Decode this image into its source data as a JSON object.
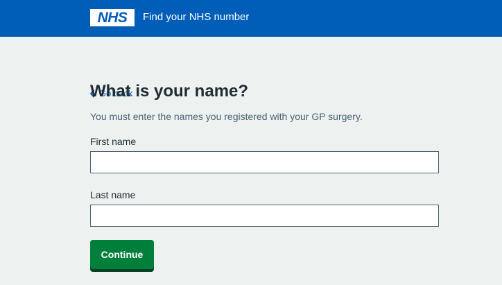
{
  "header": {
    "logo_text": "NHS",
    "service_name": "Find your NHS number",
    "colors": {
      "background": "#005eb8",
      "logo": "#ffffff"
    }
  },
  "back_link": {
    "label": "Go back",
    "icon": "chevron-left-icon"
  },
  "page": {
    "title": "What is your name?",
    "hint": "You must enter the names you registered with your GP surgery."
  },
  "form": {
    "first_name": {
      "label": "First name",
      "value": ""
    },
    "last_name": {
      "label": "Last name",
      "value": ""
    },
    "submit_label": "Continue"
  },
  "colors": {
    "page_background": "#edf2f1",
    "link": "#005eb8",
    "button": "#007f3b",
    "button_shadow": "#00401e"
  }
}
